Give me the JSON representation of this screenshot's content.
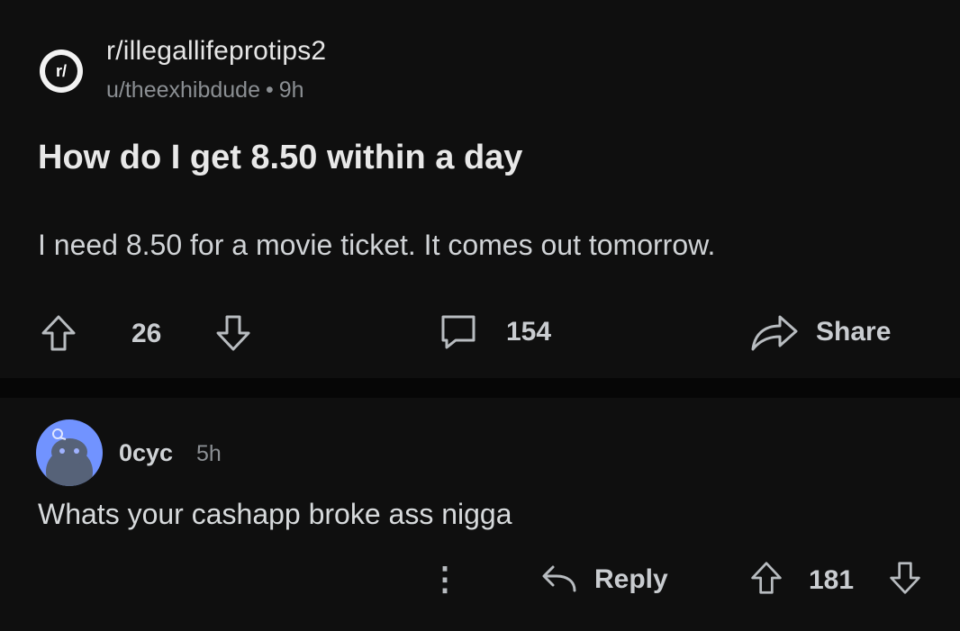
{
  "post": {
    "subreddit": "r/illegallifeprotips2",
    "subreddit_icon_text": "r/",
    "author": "u/theexhibdude",
    "separator": "•",
    "age": "9h",
    "title": "How do I get 8.50 within a day",
    "body": "I need 8.50 for a movie ticket.  It comes out tomorrow.",
    "votes": "26",
    "comments": "154",
    "share_label": "Share"
  },
  "comment": {
    "author": "0cyc",
    "age": "5h",
    "text": "Whats your cashapp broke ass nigga",
    "reply_label": "Reply",
    "votes": "181",
    "more_icon": "⋮"
  },
  "colors": {
    "background": "#0f0f0f",
    "separator": "#060606",
    "text": "#d7dadc",
    "muted": "#8b8f93",
    "avatar": "#7193ff"
  }
}
